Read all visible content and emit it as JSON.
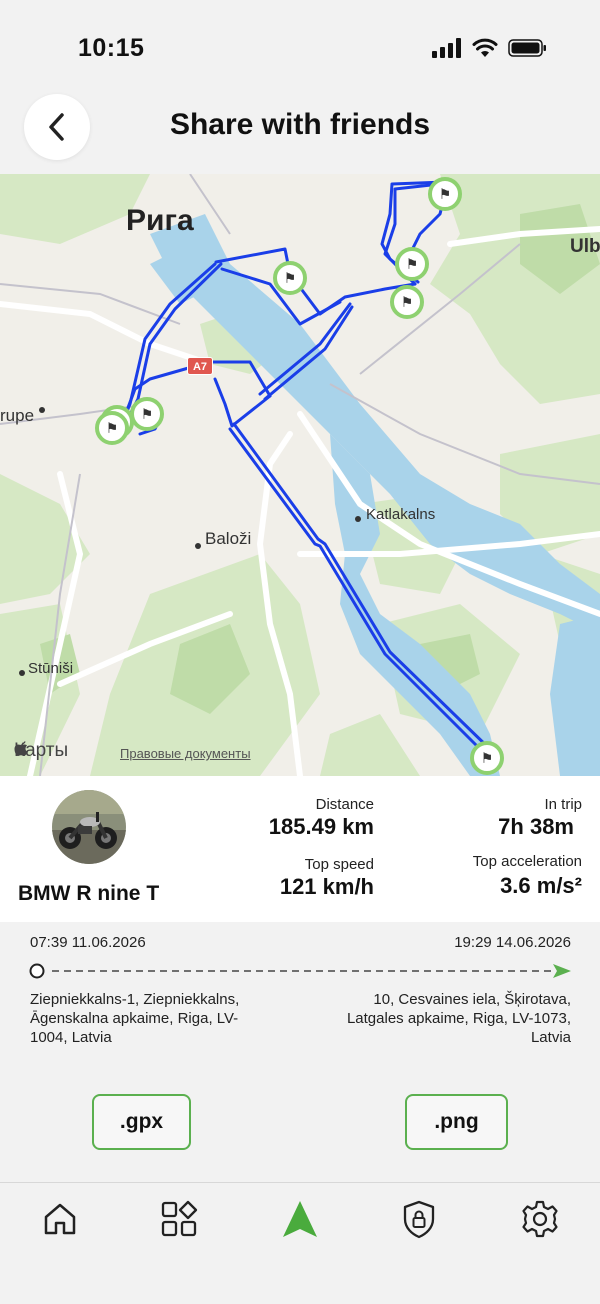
{
  "status_bar": {
    "time": "10:15"
  },
  "header": {
    "title": "Share with friends"
  },
  "map": {
    "city_label": "Рига",
    "labels": {
      "ulb": "Ulb",
      "rupe": "rupe",
      "katlakalns": "Katlakalns",
      "balozi": "Baloži",
      "stunisi": "Stūniši",
      "road_badge": "A7"
    },
    "attribution": {
      "brand": "Карты",
      "legal": "Правовые документы"
    }
  },
  "vehicle": {
    "name": "BMW R nine T"
  },
  "stats": {
    "distance": {
      "label": "Distance",
      "value": "185.49 km"
    },
    "in_trip": {
      "label": "In trip",
      "value": "7h 38m"
    },
    "top_speed": {
      "label": "Top speed",
      "value": "121 km/h"
    },
    "top_acceleration": {
      "label": "Top acceleration",
      "value": "3.6 m/s²"
    }
  },
  "trip": {
    "start_time": "07:39 11.06.2026",
    "end_time": "19:29 14.06.2026",
    "start_address": "Ziepniekkalns-1, Ziepniekkalns, Āgenskalna apkaime, Riga, LV-1004, Latvia",
    "end_address": "10, Cesvaines iela, Šķirotava, Latgales apkaime, Riga, LV-1073, Latvia"
  },
  "export": {
    "gpx_label": ".gpx",
    "png_label": ".png"
  },
  "nav": [
    "home-icon",
    "apps-icon",
    "navigation-icon",
    "security-icon",
    "settings-icon"
  ],
  "colors": {
    "accent": "#5bb04f",
    "route": "#1a3ee8"
  }
}
